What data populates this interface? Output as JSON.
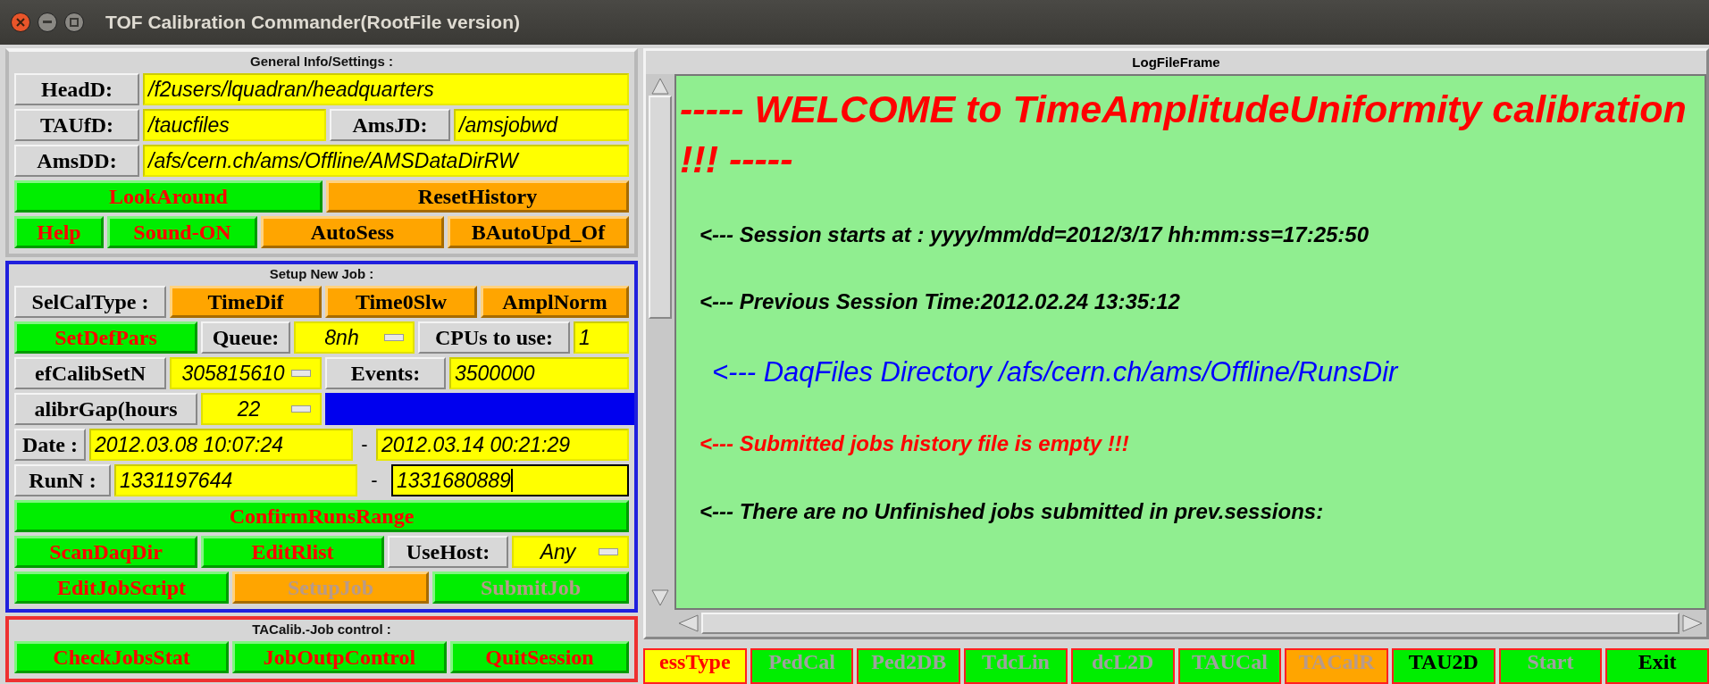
{
  "window": {
    "title": "TOF Calibration Commander(RootFile version)"
  },
  "general": {
    "title": "General Info/Settings :",
    "lines": [
      {
        "controls": [
          {
            "kind": "label",
            "text": "HeadD:"
          },
          {
            "kind": "field",
            "text": "/f2users/lquadran/headquarters"
          }
        ]
      },
      {
        "controls": [
          {
            "kind": "label",
            "text": "TAUfD:"
          },
          {
            "kind": "field",
            "text": "/taucfiles"
          },
          {
            "kind": "label",
            "text": "AmsJD:"
          },
          {
            "kind": "field",
            "text": "/amsjobwd"
          }
        ]
      },
      {
        "controls": [
          {
            "kind": "label",
            "text": "AmsDD:"
          },
          {
            "kind": "field",
            "text": "/afs/cern.ch/ams/Offline/AMSDataDirRW"
          }
        ]
      },
      {
        "controls": [
          {
            "kind": "button",
            "text": "LookAround",
            "color": "#00ee00",
            "highlighted": true,
            "disabled": false
          },
          {
            "kind": "button",
            "text": "ResetHistory",
            "color": "#ffa500",
            "highlighted": false,
            "disabled": false
          }
        ]
      },
      {
        "controls": [
          {
            "kind": "button",
            "text": "Help",
            "color": "#00ee00",
            "highlighted": true,
            "disabled": false
          },
          {
            "kind": "button",
            "text": "Sound-ON",
            "color": "#00ee00",
            "highlighted": true,
            "disabled": false
          },
          {
            "kind": "button",
            "text": "AutoSess",
            "color": "#ffa500",
            "highlighted": false,
            "disabled": false
          },
          {
            "kind": "button",
            "text": "BAutoUpd_Of",
            "color": "#ffa500",
            "highlighted": false,
            "disabled": false
          }
        ]
      }
    ]
  },
  "setup": {
    "title": "Setup New Job :",
    "lines": [
      {
        "controls": [
          {
            "kind": "label",
            "text": "SelCalType :"
          },
          {
            "kind": "button",
            "text": "TimeDif",
            "color": "#ffa500",
            "highlighted": false,
            "disabled": false
          },
          {
            "kind": "button",
            "text": "Time0Slw",
            "color": "#ffa500",
            "highlighted": false,
            "disabled": false
          },
          {
            "kind": "button",
            "text": "AmplNorm",
            "color": "#ffa500",
            "highlighted": false,
            "disabled": false
          }
        ]
      },
      {
        "controls": [
          {
            "kind": "button",
            "text": "SetDefPars",
            "color": "#00ee00",
            "highlighted": true,
            "disabled": false
          },
          {
            "kind": "label",
            "text": "Queue:"
          },
          {
            "kind": "combo",
            "text": "8nh"
          },
          {
            "kind": "label",
            "text": "CPUs to use:"
          },
          {
            "kind": "field",
            "text": "1"
          }
        ]
      },
      {
        "controls": [
          {
            "kind": "label",
            "text": "efCalibSetN"
          },
          {
            "kind": "combo",
            "text": "305815610"
          },
          {
            "kind": "label",
            "text": "Events:"
          },
          {
            "kind": "field",
            "text": "3500000"
          }
        ]
      },
      {
        "controls": [
          {
            "kind": "label",
            "text": "alibrGap(hours"
          },
          {
            "kind": "combo",
            "text": "22"
          },
          {
            "kind": "filler"
          }
        ]
      },
      {
        "controls": [
          {
            "kind": "label",
            "text": "Date :"
          },
          {
            "kind": "field",
            "text": "2012.03.08 10:07:24"
          },
          {
            "kind": "dash",
            "text": "-"
          },
          {
            "kind": "field",
            "text": "2012.03.14 00:21:29"
          }
        ]
      },
      {
        "controls": [
          {
            "kind": "label",
            "text": "RunN :"
          },
          {
            "kind": "field",
            "text": "1331197644"
          },
          {
            "kind": "dash",
            "text": "-"
          },
          {
            "kind": "field",
            "text": "1331680889",
            "focused": true
          }
        ]
      },
      {
        "controls": [
          {
            "kind": "button",
            "text": "ConfirmRunsRange",
            "color": "#00ee00",
            "highlighted": true,
            "disabled": false
          }
        ]
      },
      {
        "controls": [
          {
            "kind": "button",
            "text": "ScanDaqDir",
            "color": "#00ee00",
            "highlighted": true,
            "disabled": false
          },
          {
            "kind": "button",
            "text": "EditRlist",
            "color": "#00ee00",
            "highlighted": true,
            "disabled": false
          },
          {
            "kind": "label",
            "text": "UseHost:"
          },
          {
            "kind": "combo",
            "text": "Any"
          }
        ]
      },
      {
        "controls": [
          {
            "kind": "button",
            "text": "EditJobScript",
            "color": "#00ee00",
            "highlighted": true,
            "disabled": false
          },
          {
            "kind": "button",
            "text": "SetupJob",
            "color": "#ffa500",
            "highlighted": true,
            "disabled": true
          },
          {
            "kind": "button",
            "text": "SubmitJob",
            "color": "#00ee00",
            "highlighted": true,
            "disabled": true
          }
        ]
      }
    ]
  },
  "job_control": {
    "title": "TACalib.-Job control :",
    "lines": [
      {
        "controls": [
          {
            "kind": "button",
            "text": "CheckJobsStat",
            "color": "#00ee00",
            "highlighted": true,
            "disabled": false
          },
          {
            "kind": "button",
            "text": "JobOutpControl",
            "color": "#00ee00",
            "highlighted": true,
            "disabled": false
          },
          {
            "kind": "button",
            "text": "QuitSession",
            "color": "#00ee00",
            "highlighted": true,
            "disabled": false
          }
        ]
      }
    ]
  },
  "log": {
    "title": "LogFileFrame",
    "lines": [
      {
        "kind": "heading",
        "text": "----- WELCOME to TimeAmplitudeUniformity calibration !!! -----",
        "color": "#ff0000"
      },
      {
        "kind": "normal",
        "text": "<--- Session starts at : yyyy/mm/dd=2012/3/17 hh:mm:ss=17:25:50",
        "color": "#000000"
      },
      {
        "kind": "normal",
        "text": "<--- Previous Session Time:2012.02.24 13:35:12",
        "color": "#000000"
      },
      {
        "kind": "large",
        "text": "<--- DaqFiles Directory /afs/cern.ch/ams/Offline/RunsDir",
        "color": "#0000ff"
      },
      {
        "kind": "normal",
        "text": "<--- Submitted jobs history file is empty !!!",
        "color": "#ff0000"
      },
      {
        "kind": "normal",
        "text": "<--- There are no Unfinished jobs submitted in prev.sessions:",
        "color": "#000000"
      }
    ]
  },
  "session_bar": [
    {
      "text": "essType",
      "color": "#ffff00",
      "highlighted": true,
      "disabled": false
    },
    {
      "text": "PedCal",
      "color": "#00ee00",
      "highlighted": false,
      "disabled": true
    },
    {
      "text": "Ped2DB",
      "color": "#00ee00",
      "highlighted": false,
      "disabled": true
    },
    {
      "text": "TdcLin",
      "color": "#00ee00",
      "highlighted": false,
      "disabled": true
    },
    {
      "text": "dcL2D",
      "color": "#00ee00",
      "highlighted": false,
      "disabled": true
    },
    {
      "text": "TAUCal",
      "color": "#00ee00",
      "highlighted": false,
      "disabled": true
    },
    {
      "text": "TACalR",
      "color": "#ffa500",
      "highlighted": true,
      "disabled": true
    },
    {
      "text": "TAU2D",
      "color": "#00ee00",
      "highlighted": false,
      "disabled": false
    },
    {
      "text": "Start",
      "color": "#00ee00",
      "highlighted": false,
      "disabled": true
    },
    {
      "text": "Exit",
      "color": "#00ee00",
      "highlighted": false,
      "disabled": false
    }
  ]
}
